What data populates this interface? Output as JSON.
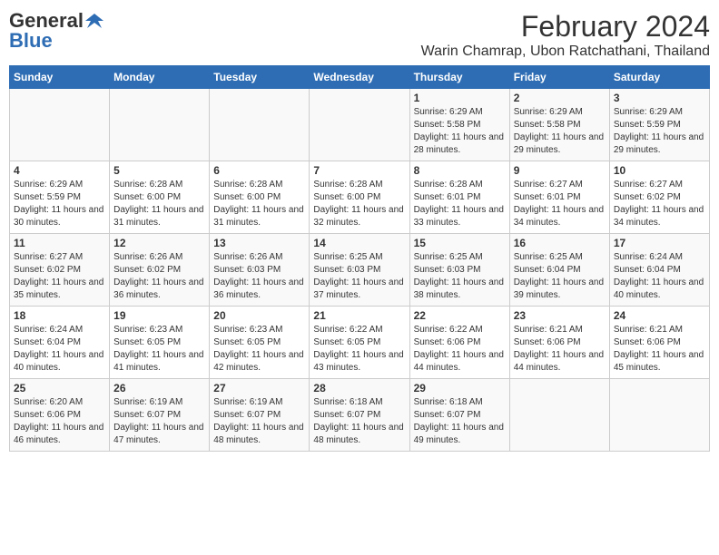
{
  "header": {
    "logo_general": "General",
    "logo_blue": "Blue",
    "title": "February 2024",
    "subtitle": "Warin Chamrap, Ubon Ratchathani, Thailand"
  },
  "days_of_week": [
    "Sunday",
    "Monday",
    "Tuesday",
    "Wednesday",
    "Thursday",
    "Friday",
    "Saturday"
  ],
  "weeks": [
    [
      {
        "day": "",
        "info": ""
      },
      {
        "day": "",
        "info": ""
      },
      {
        "day": "",
        "info": ""
      },
      {
        "day": "",
        "info": ""
      },
      {
        "day": "1",
        "info": "Sunrise: 6:29 AM\nSunset: 5:58 PM\nDaylight: 11 hours and 28 minutes."
      },
      {
        "day": "2",
        "info": "Sunrise: 6:29 AM\nSunset: 5:58 PM\nDaylight: 11 hours and 29 minutes."
      },
      {
        "day": "3",
        "info": "Sunrise: 6:29 AM\nSunset: 5:59 PM\nDaylight: 11 hours and 29 minutes."
      }
    ],
    [
      {
        "day": "4",
        "info": "Sunrise: 6:29 AM\nSunset: 5:59 PM\nDaylight: 11 hours and 30 minutes."
      },
      {
        "day": "5",
        "info": "Sunrise: 6:28 AM\nSunset: 6:00 PM\nDaylight: 11 hours and 31 minutes."
      },
      {
        "day": "6",
        "info": "Sunrise: 6:28 AM\nSunset: 6:00 PM\nDaylight: 11 hours and 31 minutes."
      },
      {
        "day": "7",
        "info": "Sunrise: 6:28 AM\nSunset: 6:00 PM\nDaylight: 11 hours and 32 minutes."
      },
      {
        "day": "8",
        "info": "Sunrise: 6:28 AM\nSunset: 6:01 PM\nDaylight: 11 hours and 33 minutes."
      },
      {
        "day": "9",
        "info": "Sunrise: 6:27 AM\nSunset: 6:01 PM\nDaylight: 11 hours and 34 minutes."
      },
      {
        "day": "10",
        "info": "Sunrise: 6:27 AM\nSunset: 6:02 PM\nDaylight: 11 hours and 34 minutes."
      }
    ],
    [
      {
        "day": "11",
        "info": "Sunrise: 6:27 AM\nSunset: 6:02 PM\nDaylight: 11 hours and 35 minutes."
      },
      {
        "day": "12",
        "info": "Sunrise: 6:26 AM\nSunset: 6:02 PM\nDaylight: 11 hours and 36 minutes."
      },
      {
        "day": "13",
        "info": "Sunrise: 6:26 AM\nSunset: 6:03 PM\nDaylight: 11 hours and 36 minutes."
      },
      {
        "day": "14",
        "info": "Sunrise: 6:25 AM\nSunset: 6:03 PM\nDaylight: 11 hours and 37 minutes."
      },
      {
        "day": "15",
        "info": "Sunrise: 6:25 AM\nSunset: 6:03 PM\nDaylight: 11 hours and 38 minutes."
      },
      {
        "day": "16",
        "info": "Sunrise: 6:25 AM\nSunset: 6:04 PM\nDaylight: 11 hours and 39 minutes."
      },
      {
        "day": "17",
        "info": "Sunrise: 6:24 AM\nSunset: 6:04 PM\nDaylight: 11 hours and 40 minutes."
      }
    ],
    [
      {
        "day": "18",
        "info": "Sunrise: 6:24 AM\nSunset: 6:04 PM\nDaylight: 11 hours and 40 minutes."
      },
      {
        "day": "19",
        "info": "Sunrise: 6:23 AM\nSunset: 6:05 PM\nDaylight: 11 hours and 41 minutes."
      },
      {
        "day": "20",
        "info": "Sunrise: 6:23 AM\nSunset: 6:05 PM\nDaylight: 11 hours and 42 minutes."
      },
      {
        "day": "21",
        "info": "Sunrise: 6:22 AM\nSunset: 6:05 PM\nDaylight: 11 hours and 43 minutes."
      },
      {
        "day": "22",
        "info": "Sunrise: 6:22 AM\nSunset: 6:06 PM\nDaylight: 11 hours and 44 minutes."
      },
      {
        "day": "23",
        "info": "Sunrise: 6:21 AM\nSunset: 6:06 PM\nDaylight: 11 hours and 44 minutes."
      },
      {
        "day": "24",
        "info": "Sunrise: 6:21 AM\nSunset: 6:06 PM\nDaylight: 11 hours and 45 minutes."
      }
    ],
    [
      {
        "day": "25",
        "info": "Sunrise: 6:20 AM\nSunset: 6:06 PM\nDaylight: 11 hours and 46 minutes."
      },
      {
        "day": "26",
        "info": "Sunrise: 6:19 AM\nSunset: 6:07 PM\nDaylight: 11 hours and 47 minutes."
      },
      {
        "day": "27",
        "info": "Sunrise: 6:19 AM\nSunset: 6:07 PM\nDaylight: 11 hours and 48 minutes."
      },
      {
        "day": "28",
        "info": "Sunrise: 6:18 AM\nSunset: 6:07 PM\nDaylight: 11 hours and 48 minutes."
      },
      {
        "day": "29",
        "info": "Sunrise: 6:18 AM\nSunset: 6:07 PM\nDaylight: 11 hours and 49 minutes."
      },
      {
        "day": "",
        "info": ""
      },
      {
        "day": "",
        "info": ""
      }
    ]
  ]
}
